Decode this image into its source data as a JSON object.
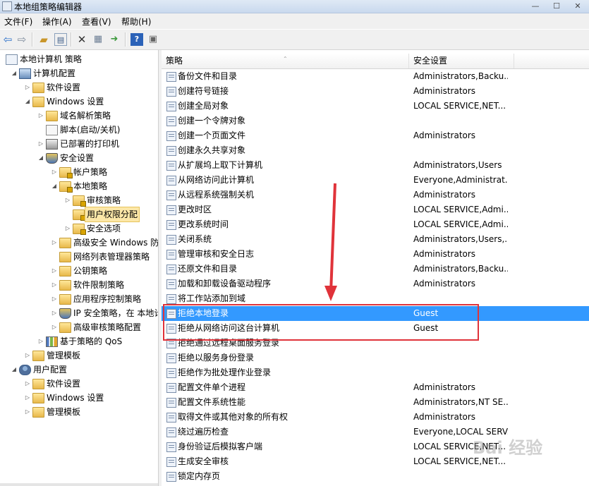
{
  "window": {
    "title": "本地组策略编辑器",
    "min": "—",
    "max": "☐",
    "close": "✕"
  },
  "menu": [
    "文件(F)",
    "操作(A)",
    "查看(V)",
    "帮助(H)"
  ],
  "toolbar_icons": [
    "back-icon",
    "forward-icon",
    "up-folder-icon",
    "show-hide-tree-icon",
    "delete-icon",
    "properties-icon",
    "export-icon",
    "help-icon",
    "console-icon"
  ],
  "tree": [
    {
      "label": "本地计算机 策略",
      "level": 0,
      "icon": "policy",
      "arrow": ""
    },
    {
      "label": "计算机配置",
      "level": 1,
      "icon": "pc",
      "arrow": "◢"
    },
    {
      "label": "软件设置",
      "level": 2,
      "icon": "folder",
      "arrow": "▷"
    },
    {
      "label": "Windows 设置",
      "level": 2,
      "icon": "folder",
      "arrow": "◢"
    },
    {
      "label": "域名解析策略",
      "level": 3,
      "icon": "folder",
      "arrow": "▷"
    },
    {
      "label": "脚本(启动/关机)",
      "level": 3,
      "icon": "script",
      "arrow": ""
    },
    {
      "label": "已部署的打印机",
      "level": 3,
      "icon": "printer",
      "arrow": "▷"
    },
    {
      "label": "安全设置",
      "level": 3,
      "icon": "shield",
      "arrow": "◢"
    },
    {
      "label": "帐户策略",
      "level": 4,
      "icon": "folder lock",
      "arrow": "▷"
    },
    {
      "label": "本地策略",
      "level": 4,
      "icon": "folder lock",
      "arrow": "◢"
    },
    {
      "label": "审核策略",
      "level": 5,
      "icon": "folder lock",
      "arrow": "▷"
    },
    {
      "label": "用户权限分配",
      "level": 5,
      "icon": "folder lock",
      "arrow": "",
      "selected": true
    },
    {
      "label": "安全选项",
      "level": 5,
      "icon": "folder lock",
      "arrow": "▷"
    },
    {
      "label": "高级安全 Windows 防火墙",
      "level": 4,
      "icon": "folder",
      "arrow": "▷"
    },
    {
      "label": "网络列表管理器策略",
      "level": 4,
      "icon": "folder",
      "arrow": ""
    },
    {
      "label": "公钥策略",
      "level": 4,
      "icon": "folder",
      "arrow": "▷"
    },
    {
      "label": "软件限制策略",
      "level": 4,
      "icon": "folder",
      "arrow": "▷"
    },
    {
      "label": "应用程序控制策略",
      "level": 4,
      "icon": "folder",
      "arrow": "▷"
    },
    {
      "label": "IP 安全策略，在 本地计算机",
      "level": 4,
      "icon": "shield",
      "arrow": "▷"
    },
    {
      "label": "高级审核策略配置",
      "level": 4,
      "icon": "folder",
      "arrow": "▷"
    },
    {
      "label": "基于策略的 QoS",
      "level": 3,
      "icon": "chart",
      "arrow": "▷"
    },
    {
      "label": "管理模板",
      "level": 2,
      "icon": "folder",
      "arrow": "▷"
    },
    {
      "label": "用户配置",
      "level": 1,
      "icon": "user",
      "arrow": "◢"
    },
    {
      "label": "软件设置",
      "level": 2,
      "icon": "folder",
      "arrow": "▷"
    },
    {
      "label": "Windows 设置",
      "level": 2,
      "icon": "folder",
      "arrow": "▷"
    },
    {
      "label": "管理模板",
      "level": 2,
      "icon": "folder",
      "arrow": "▷"
    }
  ],
  "list": {
    "headers": {
      "policy": "策略",
      "setting": "安全设置"
    },
    "rows": [
      {
        "policy": "备份文件和目录",
        "setting": "Administrators,Backu..."
      },
      {
        "policy": "创建符号链接",
        "setting": "Administrators"
      },
      {
        "policy": "创建全局对象",
        "setting": "LOCAL SERVICE,NET..."
      },
      {
        "policy": "创建一个令牌对象",
        "setting": ""
      },
      {
        "policy": "创建一个页面文件",
        "setting": "Administrators"
      },
      {
        "policy": "创建永久共享对象",
        "setting": ""
      },
      {
        "policy": "从扩展坞上取下计算机",
        "setting": "Administrators,Users"
      },
      {
        "policy": "从网络访问此计算机",
        "setting": "Everyone,Administrat..."
      },
      {
        "policy": "从远程系统强制关机",
        "setting": "Administrators"
      },
      {
        "policy": "更改时区",
        "setting": "LOCAL SERVICE,Admi..."
      },
      {
        "policy": "更改系统时间",
        "setting": "LOCAL SERVICE,Admi..."
      },
      {
        "policy": "关闭系统",
        "setting": "Administrators,Users,..."
      },
      {
        "policy": "管理审核和安全日志",
        "setting": "Administrators"
      },
      {
        "policy": "还原文件和目录",
        "setting": "Administrators,Backu..."
      },
      {
        "policy": "加载和卸载设备驱动程序",
        "setting": "Administrators"
      },
      {
        "policy": "将工作站添加到域",
        "setting": ""
      },
      {
        "policy": "拒绝本地登录",
        "setting": "Guest",
        "selected": true
      },
      {
        "policy": "拒绝从网络访问这台计算机",
        "setting": "Guest"
      },
      {
        "policy": "拒绝通过远程桌面服务登录",
        "setting": ""
      },
      {
        "policy": "拒绝以服务身份登录",
        "setting": ""
      },
      {
        "policy": "拒绝作为批处理作业登录",
        "setting": ""
      },
      {
        "policy": "配置文件单个进程",
        "setting": "Administrators"
      },
      {
        "policy": "配置文件系统性能",
        "setting": "Administrators,NT SE..."
      },
      {
        "policy": "取得文件或其他对象的所有权",
        "setting": "Administrators"
      },
      {
        "policy": "绕过遍历检查",
        "setting": "Everyone,LOCAL SERV..."
      },
      {
        "policy": "身份验证后模拟客户端",
        "setting": "LOCAL SERVICE,NET..."
      },
      {
        "policy": "生成安全审核",
        "setting": "LOCAL SERVICE,NET..."
      },
      {
        "policy": "锁定内存页",
        "setting": ""
      }
    ]
  },
  "watermark": "Bai 经验",
  "colors": {
    "selection": "#3399ff",
    "annotation": "#e0333a",
    "tree_selection": "#fce7a8"
  }
}
